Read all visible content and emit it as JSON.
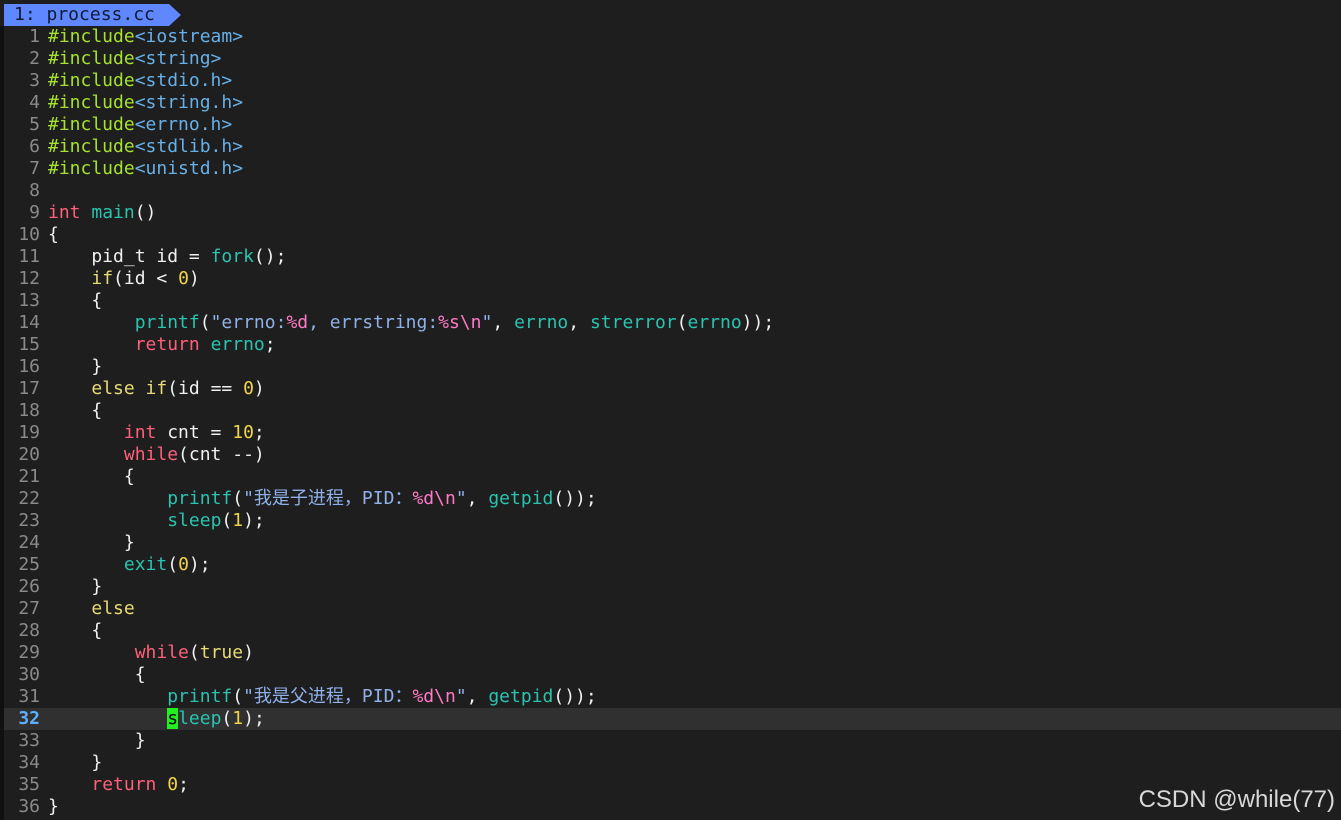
{
  "tab": {
    "label": "1: process.cc"
  },
  "watermark": "CSDN @while(77)",
  "current_line": 32,
  "colors": {
    "background": "#1e1e1e",
    "tab": "#5f87ff",
    "line_number": "#8a8a8a",
    "current_line_number": "#5fafff",
    "preproc": "#a6e22e",
    "include": "#67b0e8",
    "type": "#ff5f7a",
    "keyword": "#e6db74",
    "function": "#2ac3b0",
    "string": "#8fb0e8",
    "number": "#f2d349",
    "cursor": "#22ee22"
  },
  "lines": [
    [
      [
        "pre",
        "#include"
      ],
      [
        "inc",
        "<iostream>"
      ]
    ],
    [
      [
        "pre",
        "#include"
      ],
      [
        "inc",
        "<string>"
      ]
    ],
    [
      [
        "pre",
        "#include"
      ],
      [
        "inc",
        "<stdio.h>"
      ]
    ],
    [
      [
        "pre",
        "#include"
      ],
      [
        "inc",
        "<string.h>"
      ]
    ],
    [
      [
        "pre",
        "#include"
      ],
      [
        "inc",
        "<errno.h>"
      ]
    ],
    [
      [
        "pre",
        "#include"
      ],
      [
        "inc",
        "<stdlib.h>"
      ]
    ],
    [
      [
        "pre",
        "#include"
      ],
      [
        "inc",
        "<unistd.h>"
      ]
    ],
    [],
    [
      [
        "type",
        "int"
      ],
      [
        "norm",
        " "
      ],
      [
        "func",
        "main"
      ],
      [
        "norm",
        "()"
      ]
    ],
    [
      [
        "norm",
        "{"
      ]
    ],
    [
      [
        "norm",
        "    pid_t id = "
      ],
      [
        "func",
        "fork"
      ],
      [
        "norm",
        "();"
      ]
    ],
    [
      [
        "norm",
        "    "
      ],
      [
        "key",
        "if"
      ],
      [
        "norm",
        "(id < "
      ],
      [
        "num",
        "0"
      ],
      [
        "norm",
        ")"
      ]
    ],
    [
      [
        "norm",
        "    {"
      ]
    ],
    [
      [
        "norm",
        "        "
      ],
      [
        "func",
        "printf"
      ],
      [
        "norm",
        "("
      ],
      [
        "str",
        "\"errno:"
      ],
      [
        "fmt",
        "%d"
      ],
      [
        "str",
        ", errstring:"
      ],
      [
        "fmt",
        "%s\\n"
      ],
      [
        "str",
        "\""
      ],
      [
        "norm",
        ", "
      ],
      [
        "func",
        "errno"
      ],
      [
        "norm",
        ", "
      ],
      [
        "func",
        "strerror"
      ],
      [
        "norm",
        "("
      ],
      [
        "func",
        "errno"
      ],
      [
        "norm",
        "));"
      ]
    ],
    [
      [
        "norm",
        "        "
      ],
      [
        "type",
        "return"
      ],
      [
        "norm",
        " "
      ],
      [
        "func",
        "errno"
      ],
      [
        "norm",
        ";"
      ]
    ],
    [
      [
        "norm",
        "    }"
      ]
    ],
    [
      [
        "norm",
        "    "
      ],
      [
        "key",
        "else if"
      ],
      [
        "norm",
        "(id == "
      ],
      [
        "num",
        "0"
      ],
      [
        "norm",
        ")"
      ]
    ],
    [
      [
        "norm",
        "    {"
      ]
    ],
    [
      [
        "norm",
        "       "
      ],
      [
        "type",
        "int"
      ],
      [
        "norm",
        " cnt = "
      ],
      [
        "num",
        "10"
      ],
      [
        "norm",
        ";"
      ]
    ],
    [
      [
        "norm",
        "       "
      ],
      [
        "type",
        "while"
      ],
      [
        "norm",
        "(cnt --)"
      ]
    ],
    [
      [
        "norm",
        "       {"
      ]
    ],
    [
      [
        "norm",
        "           "
      ],
      [
        "func",
        "printf"
      ],
      [
        "norm",
        "("
      ],
      [
        "str",
        "\"我是子进程，PID："
      ],
      [
        "fmt",
        "%d\\n"
      ],
      [
        "str",
        "\""
      ],
      [
        "norm",
        ", "
      ],
      [
        "func",
        "getpid"
      ],
      [
        "norm",
        "());"
      ]
    ],
    [
      [
        "norm",
        "           "
      ],
      [
        "func",
        "sleep"
      ],
      [
        "norm",
        "("
      ],
      [
        "num",
        "1"
      ],
      [
        "norm",
        ");"
      ]
    ],
    [
      [
        "norm",
        "       }"
      ]
    ],
    [
      [
        "norm",
        "       "
      ],
      [
        "func",
        "exit"
      ],
      [
        "norm",
        "("
      ],
      [
        "num",
        "0"
      ],
      [
        "norm",
        ");"
      ]
    ],
    [
      [
        "norm",
        "    }"
      ]
    ],
    [
      [
        "norm",
        "    "
      ],
      [
        "key",
        "else"
      ]
    ],
    [
      [
        "norm",
        "    {"
      ]
    ],
    [
      [
        "norm",
        "        "
      ],
      [
        "type",
        "while"
      ],
      [
        "norm",
        "("
      ],
      [
        "key",
        "true"
      ],
      [
        "norm",
        ")"
      ]
    ],
    [
      [
        "norm",
        "        {"
      ]
    ],
    [
      [
        "norm",
        "           "
      ],
      [
        "func",
        "printf"
      ],
      [
        "norm",
        "("
      ],
      [
        "str",
        "\"我是父进程，PID："
      ],
      [
        "fmt",
        "%d\\n"
      ],
      [
        "str",
        "\""
      ],
      [
        "norm",
        ", "
      ],
      [
        "func",
        "getpid"
      ],
      [
        "norm",
        "());"
      ]
    ],
    [
      [
        "norm",
        "           "
      ],
      [
        "cursor",
        "s"
      ],
      [
        "func",
        "leep"
      ],
      [
        "norm",
        "("
      ],
      [
        "num",
        "1"
      ],
      [
        "norm",
        ");"
      ]
    ],
    [
      [
        "norm",
        "        }"
      ]
    ],
    [
      [
        "norm",
        "    }"
      ]
    ],
    [
      [
        "norm",
        "    "
      ],
      [
        "type",
        "return"
      ],
      [
        "norm",
        " "
      ],
      [
        "num",
        "0"
      ],
      [
        "norm",
        ";"
      ]
    ],
    [
      [
        "norm",
        "}"
      ]
    ]
  ]
}
